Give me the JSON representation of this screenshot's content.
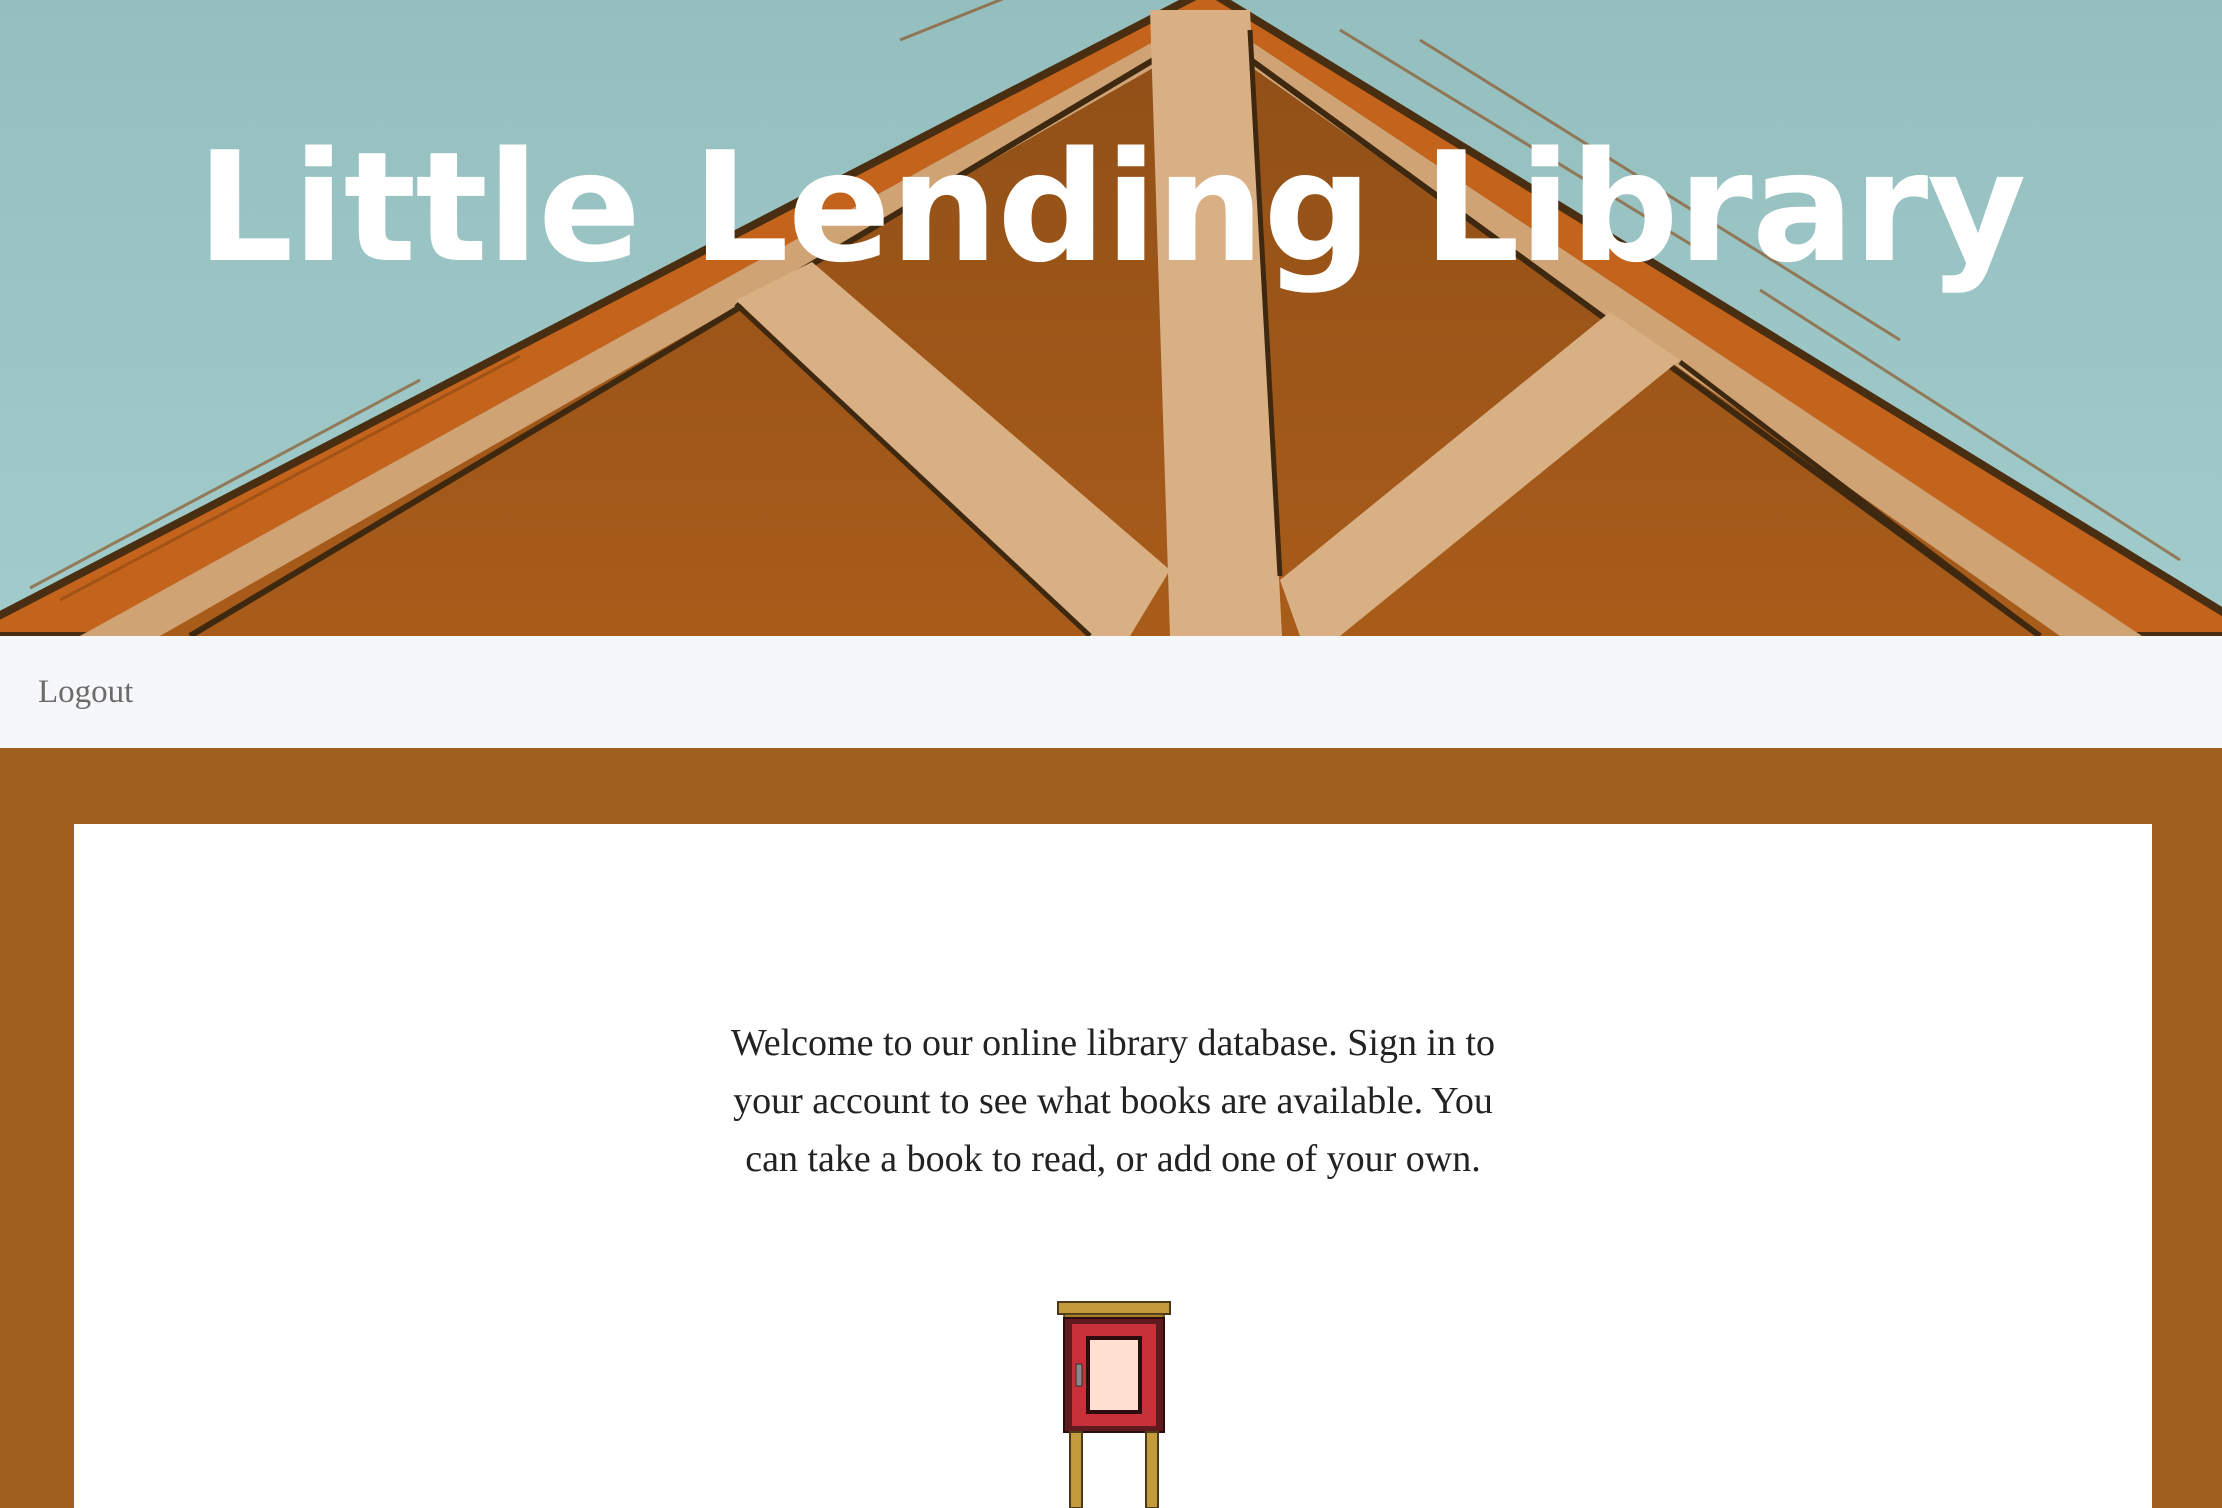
{
  "header": {
    "site_title": "Little Lending Library"
  },
  "nav": {
    "logout_label": "Logout"
  },
  "main": {
    "welcome_text": "Welcome to our online library database. Sign in to your account to see what books are available. You can take a book to read, or add one of your own."
  },
  "colors": {
    "sky": "#9bc3c3",
    "roof_orange": "#c4641c",
    "gable_brown": "#a65a1a",
    "beam_tan": "#d9b084",
    "page_background": "#a0601d",
    "navbar_background": "#f6f7f9",
    "card_background": "#ffffff"
  },
  "icons": {
    "hero_illustration": "house-roof-illustration",
    "library_box": "little-library-box-icon"
  }
}
